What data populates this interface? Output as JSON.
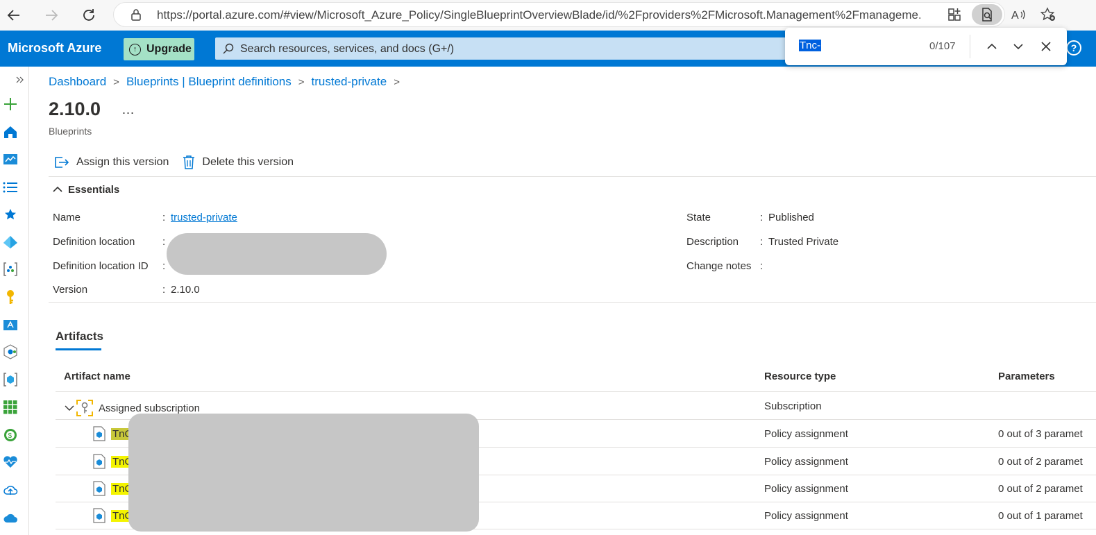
{
  "browser": {
    "url": "https://portal.azure.com/#view/Microsoft_Azure_Policy/SingleBlueprintOverviewBlade/id/%2Fproviders%2FMicrosoft.Management%2Fmanageme..."
  },
  "topbar": {
    "brand": "Microsoft Azure",
    "upgrade_label": "Upgrade",
    "search_placeholder": "Search resources, services, and docs (G+/)"
  },
  "find": {
    "query": "Tnc-",
    "count": "0/107"
  },
  "breadcrumb": [
    "Dashboard",
    "Blueprints | Blueprint definitions",
    "trusted-private"
  ],
  "page": {
    "title": "2.10.0",
    "more": "...",
    "subtitle": "Blueprints"
  },
  "commands": {
    "assign": "Assign this version",
    "delete": "Delete this version"
  },
  "essentials": {
    "heading": "Essentials",
    "left": [
      {
        "label": "Name",
        "value": "trusted-private"
      },
      {
        "label": "Definition location",
        "value": ""
      },
      {
        "label": "Definition location ID",
        "value": ""
      },
      {
        "label": "Version",
        "value": "2.10.0"
      }
    ],
    "right": [
      {
        "label": "State",
        "value": "Published"
      },
      {
        "label": "Description",
        "value": "Trusted Private"
      },
      {
        "label": "Change notes",
        "value": ""
      }
    ]
  },
  "artifacts": {
    "tab_label": "Artifacts",
    "columns": [
      "Artifact name",
      "Resource type",
      "Parameters"
    ],
    "group": {
      "name": "Assigned subscription",
      "type": "Subscription"
    },
    "rows": [
      {
        "name": "TnC",
        "type": "Policy assignment",
        "params": "0 out of 3 paramet"
      },
      {
        "name": "TnC",
        "type": "Policy assignment",
        "params": "0 out of 2 paramet"
      },
      {
        "name": "TnC",
        "type": "Policy assignment",
        "params": "0 out of 2 paramet"
      },
      {
        "name": "TnC",
        "type": "Policy assignment",
        "params": "0 out of 1 paramet"
      }
    ]
  },
  "colors": {
    "azure_blue": "#0078d4",
    "upgrade_green": "#a4e1c6",
    "search_bg": "#c7e0f4",
    "highlight": "#f4f400"
  }
}
